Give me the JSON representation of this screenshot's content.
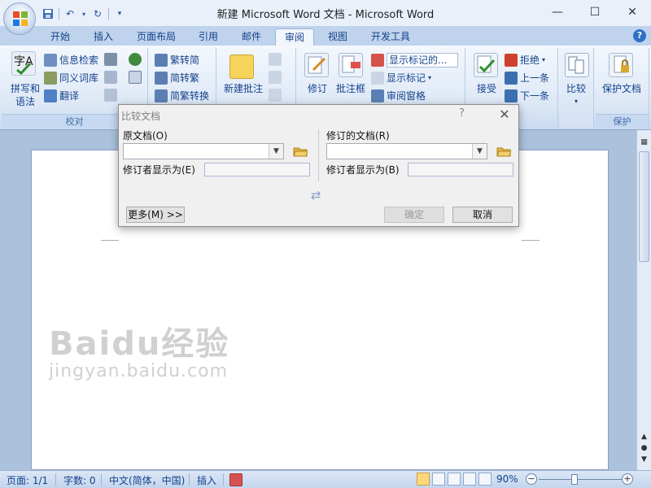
{
  "window": {
    "title": "新建 Microsoft Word 文档 - Microsoft Word",
    "minimize": "—",
    "maximize": "☐",
    "close": "✕"
  },
  "tabs": [
    {
      "label": "开始"
    },
    {
      "label": "插入"
    },
    {
      "label": "页面布局"
    },
    {
      "label": "引用"
    },
    {
      "label": "邮件"
    },
    {
      "label": "审阅"
    },
    {
      "label": "视图"
    },
    {
      "label": "开发工具"
    }
  ],
  "active_tab": "审阅",
  "ribbon": {
    "proofing": {
      "label": "校对",
      "spelling": "拼写和\n语法",
      "research": "信息检索",
      "thesaurus": "同义词库",
      "translate": "翻译"
    },
    "chinese": {
      "trad": "繁转简",
      "simp": "简转繁",
      "convert": "简繁转换"
    },
    "comments": {
      "new_comment": "新建批注"
    },
    "tracking": {
      "track_changes": "修订",
      "balloons": "批注框",
      "display": "显示标记的...",
      "show_markup": "显示标记",
      "review_pane": "审阅窗格"
    },
    "changes": {
      "accept": "接受",
      "reject": "拒绝",
      "previous": "上一条",
      "next": "下一条"
    },
    "compare": {
      "label": "比较"
    },
    "protect": {
      "label": "保护",
      "protect_doc": "保护文档"
    }
  },
  "dialog": {
    "title": "比较文档",
    "help": "?",
    "close": "✕",
    "original_label": "原文档(O)",
    "revised_label": "修订的文档(R)",
    "label_original": "修订者显示为(E)",
    "label_revised": "修订者显示为(B)",
    "more_button": "更多(M) >>",
    "ok_button": "确定",
    "cancel_button": "取消"
  },
  "statusbar": {
    "page": "页面: 1/1",
    "words": "字数: 0",
    "language": "中文(简体，中国)",
    "insert": "插入",
    "zoom": "90%"
  },
  "watermark": {
    "line1": "Baidu经验",
    "line2": "jingyan.baidu.com"
  }
}
